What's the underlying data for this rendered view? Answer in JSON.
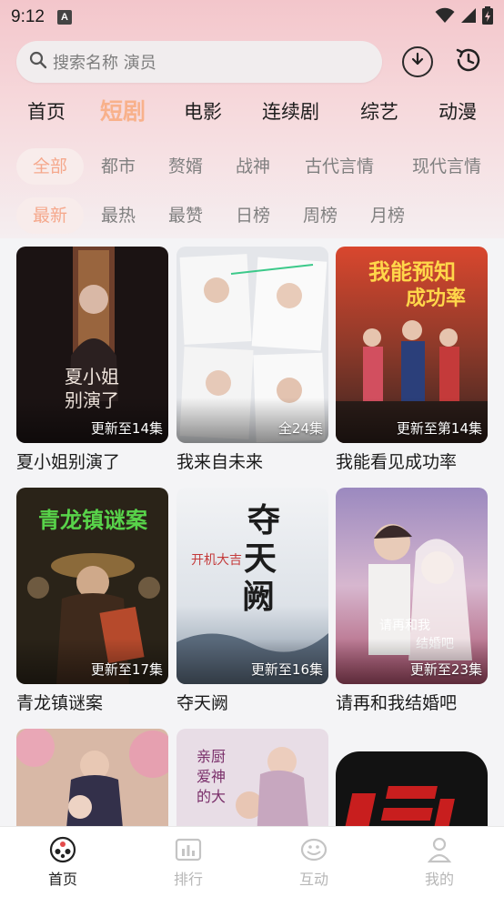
{
  "status_bar": {
    "time": "9:12",
    "sim_label": "A"
  },
  "search": {
    "placeholder": "搜索名称 演员"
  },
  "main_tabs": [
    {
      "label": "首页",
      "active": false
    },
    {
      "label": "短剧",
      "active": true
    },
    {
      "label": "电影",
      "active": false
    },
    {
      "label": "连续剧",
      "active": false
    },
    {
      "label": "综艺",
      "active": false
    },
    {
      "label": "动漫",
      "active": false
    }
  ],
  "genre_filters": [
    {
      "label": "全部",
      "active": true
    },
    {
      "label": "都市",
      "active": false
    },
    {
      "label": "赘婿",
      "active": false
    },
    {
      "label": "战神",
      "active": false
    },
    {
      "label": "古代言情",
      "active": false
    },
    {
      "label": "现代言情",
      "active": false
    }
  ],
  "sort_filters": [
    {
      "label": "最新",
      "active": true
    },
    {
      "label": "最热",
      "active": false
    },
    {
      "label": "最赞",
      "active": false
    },
    {
      "label": "日榜",
      "active": false
    },
    {
      "label": "周榜",
      "active": false
    },
    {
      "label": "月榜",
      "active": false
    }
  ],
  "cards": [
    {
      "title": "夏小姐别演了",
      "badge": "更新至14集",
      "poster_colors": [
        "#1c1414",
        "#4a2a22"
      ]
    },
    {
      "title": "我来自未来",
      "badge": "全24集",
      "poster_colors": [
        "#e6e8ec",
        "#c9d3dc"
      ]
    },
    {
      "title": "我能看见成功率",
      "badge": "更新至第14集",
      "poster_colors": [
        "#8a3a2c",
        "#e2a24a"
      ]
    },
    {
      "title": "青龙镇谜案",
      "badge": "更新至17集",
      "poster_colors": [
        "#2f2a1c",
        "#6b3e1f"
      ]
    },
    {
      "title": "夺天阙",
      "badge": "更新至16集",
      "poster_colors": [
        "#e9ebef",
        "#9aa8b8"
      ]
    },
    {
      "title": "请再和我结婚吧",
      "badge": "更新至23集",
      "poster_colors": [
        "#a690b8",
        "#f1d4df"
      ]
    },
    {
      "title": "",
      "badge": "",
      "poster_colors": [
        "#d9b7a8",
        "#5b3c5a"
      ]
    },
    {
      "title": "",
      "badge": "",
      "poster_colors": [
        "#e6d9e3",
        "#a67f96"
      ]
    }
  ],
  "bottom_nav": [
    {
      "label": "首页",
      "icon": "film-reel-icon",
      "active": true
    },
    {
      "label": "排行",
      "icon": "chart-icon",
      "active": false
    },
    {
      "label": "互动",
      "icon": "chat-face-icon",
      "active": false
    },
    {
      "label": "我的",
      "icon": "profile-icon",
      "active": false
    }
  ],
  "colors": {
    "accent": "#f5a88c",
    "header_gradient_top": "#f3c6cb",
    "page_bg": "#f4f4f6"
  }
}
